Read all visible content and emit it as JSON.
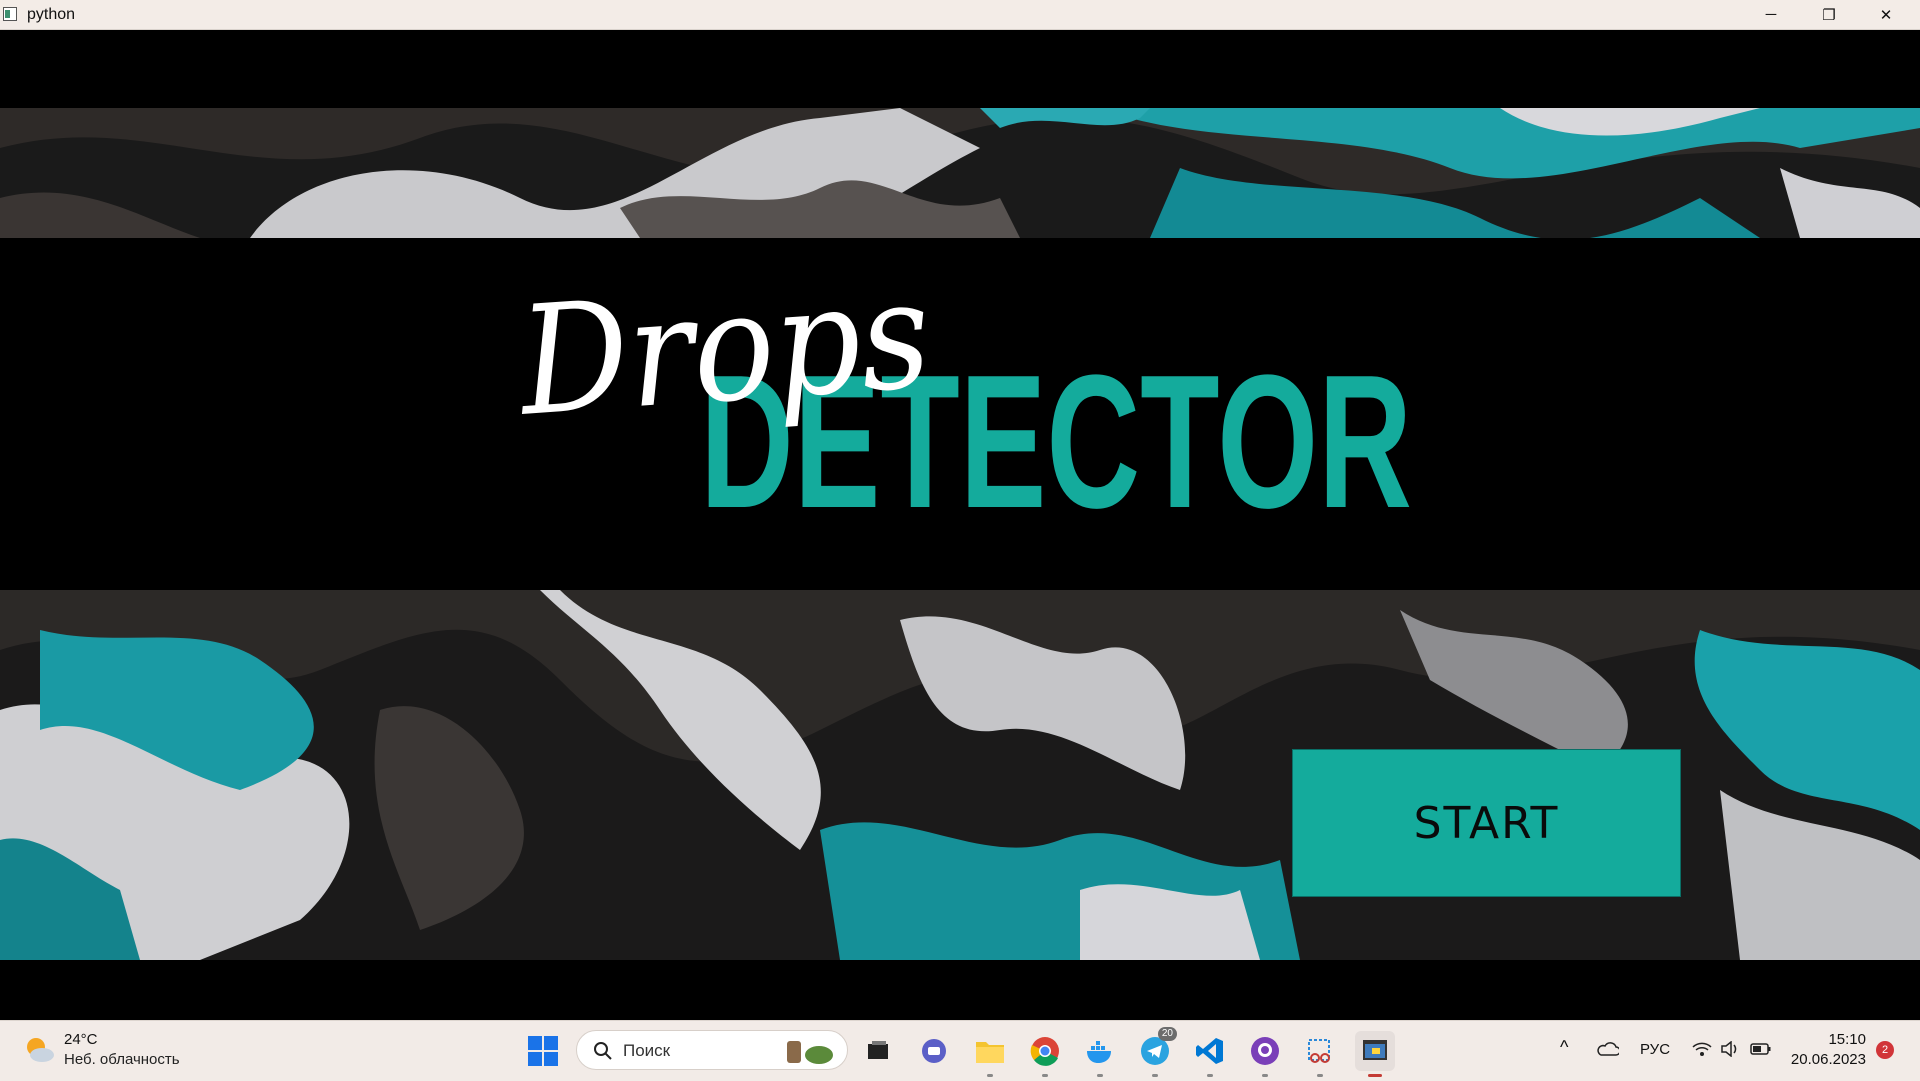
{
  "window": {
    "title": "python",
    "controls": {
      "minimize": "─",
      "restore": "❐",
      "close": "✕"
    }
  },
  "logo": {
    "script_word": "Drops",
    "main_word": "DETECTOR"
  },
  "main": {
    "start_label": "START"
  },
  "taskbar": {
    "weather": {
      "temp": "24°C",
      "desc": "Неб. облачность"
    },
    "search_placeholder": "Поиск",
    "apps": [
      {
        "name": "task-view",
        "badge": ""
      },
      {
        "name": "teams-chat",
        "badge": ""
      },
      {
        "name": "file-explorer",
        "badge": ""
      },
      {
        "name": "chrome",
        "badge": ""
      },
      {
        "name": "docker",
        "badge": ""
      },
      {
        "name": "telegram",
        "badge": "20"
      },
      {
        "name": "vscode",
        "badge": ""
      },
      {
        "name": "github-desktop",
        "badge": ""
      },
      {
        "name": "snipping-tool",
        "badge": ""
      },
      {
        "name": "python",
        "badge": ""
      }
    ],
    "tray": {
      "language": "РУС",
      "chevron": "^"
    },
    "clock": {
      "time": "15:10",
      "date": "20.06.2023"
    },
    "notifications": "2"
  },
  "colors": {
    "accent": "#14ab9c",
    "background": "#000000",
    "taskbar": "#f2ebe7"
  }
}
